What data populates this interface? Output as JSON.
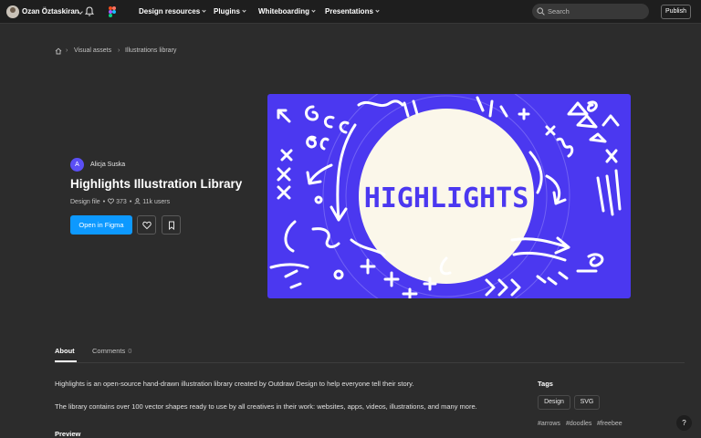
{
  "topbar": {
    "user_name": "Ozan Öztaskiran",
    "nav": [
      {
        "label": "Design resources"
      },
      {
        "label": "Plugins"
      },
      {
        "label": "Whiteboarding"
      },
      {
        "label": "Presentations"
      }
    ],
    "search_placeholder": "Search",
    "publish_label": "Publish"
  },
  "breadcrumb": {
    "items": [
      "Visual assets",
      "Illustrations library"
    ]
  },
  "resource": {
    "author_initial": "A",
    "author_name": "Alicja Suska",
    "title": "Highlights Illustration Library",
    "type": "Design file",
    "likes": "373",
    "users": "11k users",
    "open_label": "Open in Figma",
    "thumbnail_text": "HIGHLIGHTS",
    "thumbnail_color": "#4b38f0"
  },
  "tabs": {
    "about": "About",
    "comments": "Comments",
    "comments_count": "0"
  },
  "description": {
    "p1": "Highlights is an open-source hand-drawn illustration library created by Outdraw Design to help everyone tell their story.",
    "p2": "The library contains over 100 vector shapes ready to use by all creatives in their work: websites, apps, videos, illustrations, and many more.",
    "preview_heading": "Preview"
  },
  "tags": {
    "heading": "Tags",
    "pills": [
      "Design",
      "SVG"
    ],
    "hashtags": [
      "#arrows",
      "#doodles",
      "#freebee"
    ]
  },
  "help_label": "?"
}
